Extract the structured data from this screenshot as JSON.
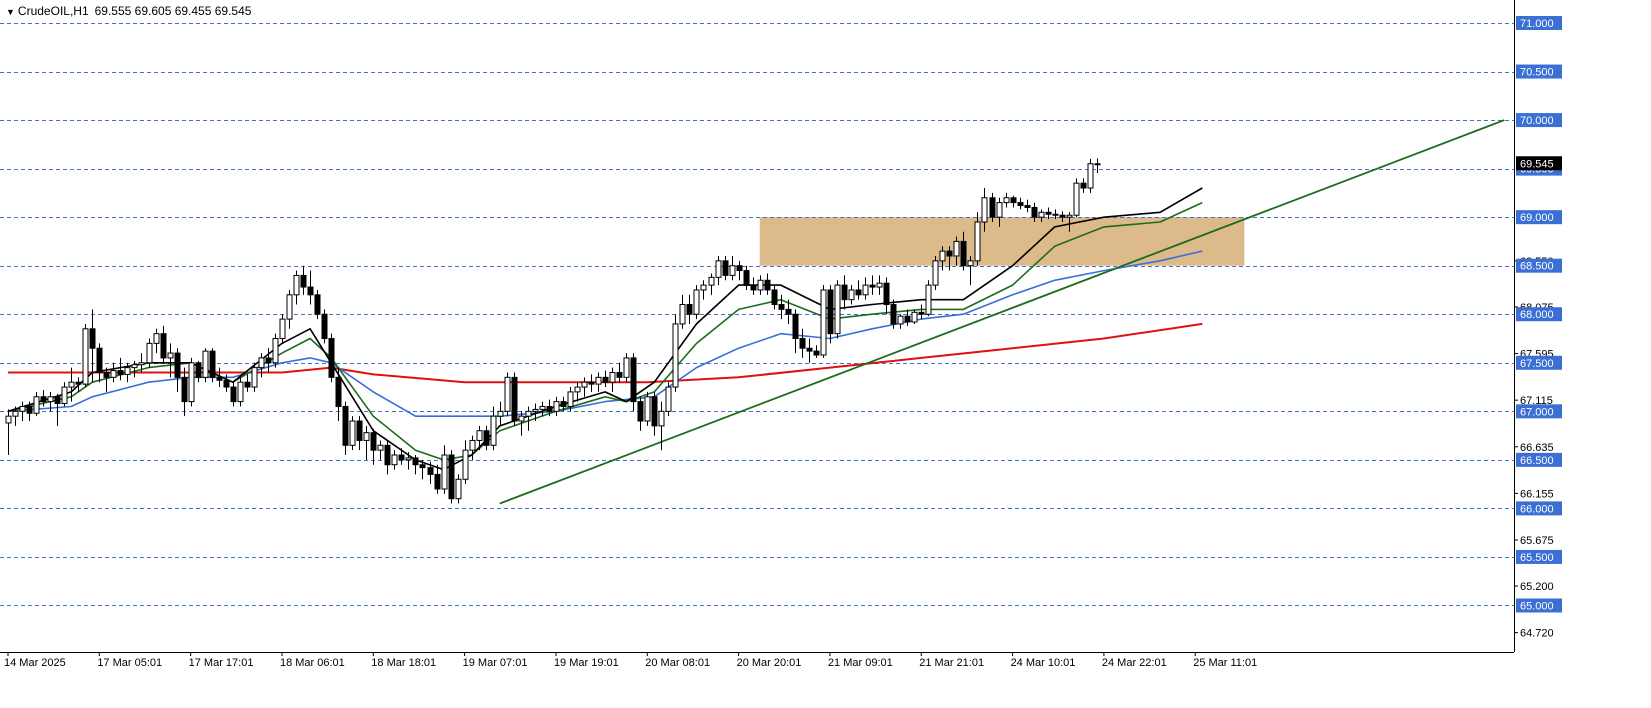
{
  "header": {
    "symbol": "CrudeOIL,H1",
    "ohlc": "69.555 69.605 69.455 69.545"
  },
  "colors": {
    "grid": "#4472c4",
    "ema_fast": "#000000",
    "ema_mid": "#1e6b1e",
    "ema_slow": "#3a6fd8",
    "ema_long": "#e01010",
    "trendline": "#1e6b1e",
    "zone": "#d9b37d",
    "level_box": "#3b6fd4"
  },
  "chart_data": {
    "type": "candlestick",
    "y_axis": {
      "min": 64.5,
      "max": 71.2,
      "tick_labels": [
        "68.550",
        "68.075",
        "67.595",
        "67.115",
        "66.635",
        "66.155",
        "65.675",
        "65.200",
        "64.720"
      ],
      "tick_values": [
        68.55,
        68.075,
        67.595,
        67.115,
        66.635,
        66.155,
        65.675,
        65.2,
        64.72
      ]
    },
    "price_levels": [
      {
        "label": "71.000",
        "value": 71.0
      },
      {
        "label": "70.500",
        "value": 70.5
      },
      {
        "label": "70.000",
        "value": 70.0
      },
      {
        "label": "69.500",
        "value": 69.5
      },
      {
        "label": "69.000",
        "value": 69.0
      },
      {
        "label": "68.500",
        "value": 68.5
      },
      {
        "label": "68.000",
        "value": 68.0
      },
      {
        "label": "67.500",
        "value": 67.5
      },
      {
        "label": "67.000",
        "value": 67.0
      },
      {
        "label": "66.500",
        "value": 66.5
      },
      {
        "label": "66.000",
        "value": 66.0
      },
      {
        "label": "65.500",
        "value": 65.5
      },
      {
        "label": "65.000",
        "value": 65.0
      }
    ],
    "current_price": {
      "label": "69.545",
      "value": 69.545
    },
    "x_axis": {
      "labels": [
        "14 Mar 2025",
        "17 Mar 05:01",
        "17 Mar 17:01",
        "18 Mar 06:01",
        "18 Mar 18:01",
        "19 Mar 07:01",
        "19 Mar 19:01",
        "20 Mar 08:01",
        "20 Mar 20:01",
        "21 Mar 09:01",
        "21 Mar 21:01",
        "24 Mar 10:01",
        "24 Mar 22:01",
        "25 Mar 11:01"
      ],
      "label_bars": [
        0,
        13,
        26,
        39,
        52,
        65,
        78,
        91,
        104,
        117,
        130,
        143,
        156,
        169
      ]
    },
    "candles": [
      [
        66.88,
        67.02,
        66.55,
        66.95
      ],
      [
        66.95,
        67.05,
        66.85,
        67.0
      ],
      [
        67.0,
        67.1,
        66.9,
        67.05
      ],
      [
        67.05,
        67.1,
        66.9,
        66.98
      ],
      [
        66.98,
        67.2,
        66.95,
        67.15
      ],
      [
        67.15,
        67.22,
        67.05,
        67.1
      ],
      [
        67.1,
        67.2,
        67.0,
        67.15
      ],
      [
        67.15,
        67.18,
        66.85,
        67.08
      ],
      [
        67.08,
        67.3,
        67.05,
        67.25
      ],
      [
        67.25,
        67.45,
        67.1,
        67.3
      ],
      [
        67.3,
        67.35,
        67.2,
        67.28
      ],
      [
        67.28,
        67.9,
        67.25,
        67.85
      ],
      [
        67.85,
        68.05,
        67.3,
        67.65
      ],
      [
        67.65,
        67.7,
        67.3,
        67.4
      ],
      [
        67.4,
        67.45,
        67.2,
        67.35
      ],
      [
        67.35,
        67.5,
        67.3,
        67.42
      ],
      [
        67.42,
        67.55,
        67.32,
        67.38
      ],
      [
        67.38,
        67.5,
        67.3,
        67.45
      ],
      [
        67.45,
        67.52,
        67.35,
        67.48
      ],
      [
        67.48,
        67.6,
        67.4,
        67.5
      ],
      [
        67.5,
        67.75,
        67.45,
        67.7
      ],
      [
        67.7,
        67.85,
        67.6,
        67.8
      ],
      [
        67.8,
        67.88,
        67.5,
        67.55
      ],
      [
        67.55,
        67.7,
        67.35,
        67.6
      ],
      [
        67.6,
        67.65,
        67.2,
        67.35
      ],
      [
        67.35,
        67.45,
        66.95,
        67.1
      ],
      [
        67.1,
        67.55,
        67.05,
        67.5
      ],
      [
        67.5,
        67.52,
        67.3,
        67.35
      ],
      [
        67.35,
        67.65,
        67.3,
        67.62
      ],
      [
        67.62,
        67.65,
        67.3,
        67.35
      ],
      [
        67.35,
        67.45,
        67.25,
        67.32
      ],
      [
        67.32,
        67.38,
        67.2,
        67.25
      ],
      [
        67.25,
        67.3,
        67.05,
        67.1
      ],
      [
        67.1,
        67.35,
        67.05,
        67.3
      ],
      [
        67.3,
        67.38,
        67.2,
        67.25
      ],
      [
        67.25,
        67.5,
        67.2,
        67.45
      ],
      [
        67.45,
        67.6,
        67.35,
        67.55
      ],
      [
        67.55,
        67.65,
        67.4,
        67.5
      ],
      [
        67.5,
        67.8,
        67.45,
        67.75
      ],
      [
        67.75,
        68.0,
        67.7,
        67.95
      ],
      [
        67.95,
        68.25,
        67.85,
        68.2
      ],
      [
        68.2,
        68.45,
        68.1,
        68.4
      ],
      [
        68.4,
        68.5,
        68.2,
        68.28
      ],
      [
        68.28,
        68.45,
        68.1,
        68.2
      ],
      [
        68.2,
        68.25,
        67.95,
        68.0
      ],
      [
        68.0,
        68.05,
        67.7,
        67.75
      ],
      [
        67.75,
        67.8,
        67.3,
        67.35
      ],
      [
        67.35,
        67.45,
        66.9,
        67.05
      ],
      [
        67.05,
        67.1,
        66.55,
        66.65
      ],
      [
        66.65,
        66.95,
        66.6,
        66.9
      ],
      [
        66.9,
        66.95,
        66.6,
        66.7
      ],
      [
        66.7,
        66.85,
        66.5,
        66.78
      ],
      [
        66.78,
        66.82,
        66.45,
        66.6
      ],
      [
        66.6,
        66.7,
        66.5,
        66.65
      ],
      [
        66.65,
        66.7,
        66.35,
        66.45
      ],
      [
        66.45,
        66.6,
        66.4,
        66.55
      ],
      [
        66.55,
        66.62,
        66.45,
        66.5
      ],
      [
        66.5,
        66.58,
        66.4,
        66.52
      ],
      [
        66.52,
        66.55,
        66.35,
        66.45
      ],
      [
        66.45,
        66.5,
        66.3,
        66.42
      ],
      [
        66.42,
        66.48,
        66.25,
        66.35
      ],
      [
        66.35,
        66.45,
        66.15,
        66.2
      ],
      [
        66.2,
        66.65,
        66.15,
        66.55
      ],
      [
        66.55,
        66.6,
        66.05,
        66.1
      ],
      [
        66.1,
        66.35,
        66.05,
        66.3
      ],
      [
        66.3,
        66.7,
        66.25,
        66.6
      ],
      [
        66.6,
        66.75,
        66.5,
        66.7
      ],
      [
        66.7,
        66.85,
        66.6,
        66.8
      ],
      [
        66.8,
        66.85,
        66.6,
        66.65
      ],
      [
        66.65,
        67.05,
        66.6,
        66.95
      ],
      [
        66.95,
        67.1,
        66.85,
        67.0
      ],
      [
        67.0,
        67.4,
        66.95,
        67.35
      ],
      [
        67.35,
        67.4,
        66.85,
        66.9
      ],
      [
        66.9,
        67.0,
        66.75,
        66.95
      ],
      [
        66.95,
        67.05,
        66.8,
        67.0
      ],
      [
        67.0,
        67.08,
        66.9,
        67.02
      ],
      [
        67.02,
        67.1,
        66.95,
        67.05
      ],
      [
        67.05,
        67.12,
        66.95,
        67.0
      ],
      [
        67.0,
        67.15,
        66.95,
        67.1
      ],
      [
        67.1,
        67.15,
        67.0,
        67.05
      ],
      [
        67.05,
        67.25,
        67.0,
        67.2
      ],
      [
        67.2,
        67.3,
        67.1,
        67.25
      ],
      [
        67.25,
        67.35,
        67.15,
        67.3
      ],
      [
        67.3,
        67.38,
        67.2,
        67.28
      ],
      [
        67.28,
        67.4,
        67.2,
        67.35
      ],
      [
        67.35,
        67.42,
        67.25,
        67.3
      ],
      [
        67.3,
        67.45,
        67.2,
        67.4
      ],
      [
        67.4,
        67.5,
        67.3,
        67.35
      ],
      [
        67.35,
        67.6,
        67.3,
        67.55
      ],
      [
        67.55,
        67.6,
        67.0,
        67.1
      ],
      [
        67.1,
        67.15,
        66.8,
        66.9
      ],
      [
        66.9,
        67.2,
        66.85,
        67.15
      ],
      [
        67.15,
        67.2,
        66.75,
        66.85
      ],
      [
        66.85,
        67.1,
        66.6,
        67.0
      ],
      [
        67.0,
        67.3,
        66.95,
        67.25
      ],
      [
        67.25,
        68.0,
        67.2,
        67.9
      ],
      [
        67.9,
        68.2,
        67.85,
        68.1
      ],
      [
        68.1,
        68.2,
        67.9,
        68.0
      ],
      [
        68.0,
        68.3,
        67.95,
        68.25
      ],
      [
        68.25,
        68.35,
        68.15,
        68.3
      ],
      [
        68.3,
        68.42,
        68.2,
        68.38
      ],
      [
        68.38,
        68.6,
        68.3,
        68.55
      ],
      [
        68.55,
        68.6,
        68.35,
        68.4
      ],
      [
        68.4,
        68.6,
        68.35,
        68.5
      ],
      [
        68.5,
        68.55,
        68.35,
        68.45
      ],
      [
        68.45,
        68.5,
        68.25,
        68.3
      ],
      [
        68.3,
        68.38,
        68.2,
        68.25
      ],
      [
        68.25,
        68.4,
        68.2,
        68.35
      ],
      [
        68.35,
        68.42,
        68.2,
        68.25
      ],
      [
        68.25,
        68.3,
        68.05,
        68.1
      ],
      [
        68.1,
        68.2,
        67.95,
        68.05
      ],
      [
        68.05,
        68.15,
        67.9,
        68.0
      ],
      [
        68.0,
        68.05,
        67.6,
        67.75
      ],
      [
        67.75,
        67.85,
        67.55,
        67.65
      ],
      [
        67.65,
        67.75,
        67.5,
        67.62
      ],
      [
        67.62,
        67.68,
        67.55,
        67.58
      ],
      [
        67.58,
        68.3,
        67.55,
        68.25
      ],
      [
        68.25,
        68.3,
        67.7,
        67.8
      ],
      [
        67.8,
        68.35,
        67.75,
        68.3
      ],
      [
        68.3,
        68.4,
        68.05,
        68.15
      ],
      [
        68.15,
        68.3,
        68.1,
        68.25
      ],
      [
        68.25,
        68.35,
        68.15,
        68.2
      ],
      [
        68.2,
        68.38,
        68.15,
        68.3
      ],
      [
        68.3,
        68.4,
        68.2,
        68.28
      ],
      [
        68.28,
        68.4,
        68.2,
        68.32
      ],
      [
        68.32,
        68.38,
        68.0,
        68.1
      ],
      [
        68.1,
        68.15,
        67.85,
        67.9
      ],
      [
        67.9,
        68.0,
        67.85,
        67.98
      ],
      [
        67.98,
        68.05,
        67.88,
        67.92
      ],
      [
        67.92,
        68.05,
        67.9,
        68.02
      ],
      [
        68.02,
        68.1,
        67.95,
        68.0
      ],
      [
        68.0,
        68.35,
        67.98,
        68.3
      ],
      [
        68.3,
        68.6,
        68.25,
        68.55
      ],
      [
        68.55,
        68.7,
        68.45,
        68.65
      ],
      [
        68.65,
        68.7,
        68.45,
        68.6
      ],
      [
        68.6,
        68.8,
        68.5,
        68.75
      ],
      [
        68.75,
        68.85,
        68.45,
        68.5
      ],
      [
        68.5,
        68.6,
        68.3,
        68.55
      ],
      [
        68.55,
        69.05,
        68.5,
        68.95
      ],
      [
        68.95,
        69.3,
        68.85,
        69.2
      ],
      [
        69.2,
        69.25,
        68.95,
        69.0
      ],
      [
        69.0,
        69.2,
        68.9,
        69.15
      ],
      [
        69.15,
        69.25,
        69.1,
        69.2
      ],
      [
        69.2,
        69.22,
        69.1,
        69.15
      ],
      [
        69.15,
        69.2,
        69.08,
        69.12
      ],
      [
        69.12,
        69.18,
        69.05,
        69.1
      ],
      [
        69.1,
        69.15,
        68.95,
        69.0
      ],
      [
        69.0,
        69.08,
        68.95,
        69.05
      ],
      [
        69.05,
        69.1,
        68.98,
        69.03
      ],
      [
        69.03,
        69.08,
        68.98,
        69.02
      ],
      [
        69.02,
        69.06,
        68.95,
        69.0
      ],
      [
        69.0,
        69.05,
        68.85,
        69.02
      ],
      [
        69.02,
        69.4,
        69.0,
        69.35
      ],
      [
        69.35,
        69.4,
        69.25,
        69.3
      ],
      [
        69.3,
        69.6,
        69.25,
        69.55
      ],
      [
        69.55,
        69.605,
        69.455,
        69.545
      ]
    ],
    "ema_fast": [
      [
        0,
        67.0
      ],
      [
        9,
        67.2
      ],
      [
        12,
        67.4
      ],
      [
        20,
        67.5
      ],
      [
        26,
        67.5
      ],
      [
        32,
        67.3
      ],
      [
        39,
        67.7
      ],
      [
        43,
        67.85
      ],
      [
        46,
        67.5
      ],
      [
        52,
        66.8
      ],
      [
        58,
        66.5
      ],
      [
        62,
        66.4
      ],
      [
        66,
        66.55
      ],
      [
        70,
        66.85
      ],
      [
        78,
        67.05
      ],
      [
        85,
        67.2
      ],
      [
        88,
        67.1
      ],
      [
        92,
        67.3
      ],
      [
        98,
        67.9
      ],
      [
        104,
        68.3
      ],
      [
        110,
        68.3
      ],
      [
        117,
        68.05
      ],
      [
        123,
        68.1
      ],
      [
        130,
        68.15
      ],
      [
        136,
        68.15
      ],
      [
        143,
        68.5
      ],
      [
        149,
        68.9
      ],
      [
        156,
        69.0
      ],
      [
        164,
        69.05
      ],
      [
        170,
        69.3
      ]
    ],
    "ema_mid": [
      [
        0,
        67.0
      ],
      [
        9,
        67.15
      ],
      [
        12,
        67.3
      ],
      [
        20,
        67.45
      ],
      [
        26,
        67.5
      ],
      [
        32,
        67.3
      ],
      [
        39,
        67.6
      ],
      [
        43,
        67.75
      ],
      [
        46,
        67.55
      ],
      [
        52,
        66.95
      ],
      [
        58,
        66.6
      ],
      [
        62,
        66.5
      ],
      [
        66,
        66.55
      ],
      [
        70,
        66.8
      ],
      [
        78,
        67.0
      ],
      [
        85,
        67.15
      ],
      [
        88,
        67.1
      ],
      [
        92,
        67.2
      ],
      [
        98,
        67.7
      ],
      [
        104,
        68.05
      ],
      [
        110,
        68.15
      ],
      [
        117,
        67.95
      ],
      [
        123,
        68.0
      ],
      [
        130,
        68.05
      ],
      [
        136,
        68.05
      ],
      [
        143,
        68.3
      ],
      [
        149,
        68.7
      ],
      [
        156,
        68.9
      ],
      [
        164,
        68.95
      ],
      [
        170,
        69.15
      ]
    ],
    "ema_slow": [
      [
        0,
        67.0
      ],
      [
        9,
        67.05
      ],
      [
        12,
        67.15
      ],
      [
        20,
        67.3
      ],
      [
        26,
        67.35
      ],
      [
        32,
        67.35
      ],
      [
        39,
        67.5
      ],
      [
        43,
        67.55
      ],
      [
        46,
        67.5
      ],
      [
        52,
        67.2
      ],
      [
        58,
        66.95
      ],
      [
        64,
        66.95
      ],
      [
        70,
        66.95
      ],
      [
        78,
        67.0
      ],
      [
        85,
        67.1
      ],
      [
        92,
        67.15
      ],
      [
        98,
        67.45
      ],
      [
        104,
        67.65
      ],
      [
        110,
        67.8
      ],
      [
        117,
        67.75
      ],
      [
        123,
        67.85
      ],
      [
        130,
        67.95
      ],
      [
        136,
        68.0
      ],
      [
        143,
        68.2
      ],
      [
        149,
        68.35
      ],
      [
        156,
        68.45
      ],
      [
        164,
        68.55
      ],
      [
        170,
        68.65
      ]
    ],
    "ema_long": [
      [
        0,
        67.4
      ],
      [
        13,
        67.4
      ],
      [
        26,
        67.4
      ],
      [
        39,
        67.4
      ],
      [
        46,
        67.45
      ],
      [
        52,
        67.38
      ],
      [
        65,
        67.3
      ],
      [
        78,
        67.3
      ],
      [
        91,
        67.3
      ],
      [
        104,
        67.35
      ],
      [
        117,
        67.45
      ],
      [
        130,
        67.55
      ],
      [
        143,
        67.65
      ],
      [
        156,
        67.75
      ],
      [
        170,
        67.9
      ]
    ],
    "trendline": {
      "from": [
        70,
        66.05
      ],
      "to": [
        213,
        70.0
      ]
    },
    "zone": {
      "from_bar": 107,
      "to_bar": 176,
      "top": 69.0,
      "bottom": 68.5
    }
  }
}
